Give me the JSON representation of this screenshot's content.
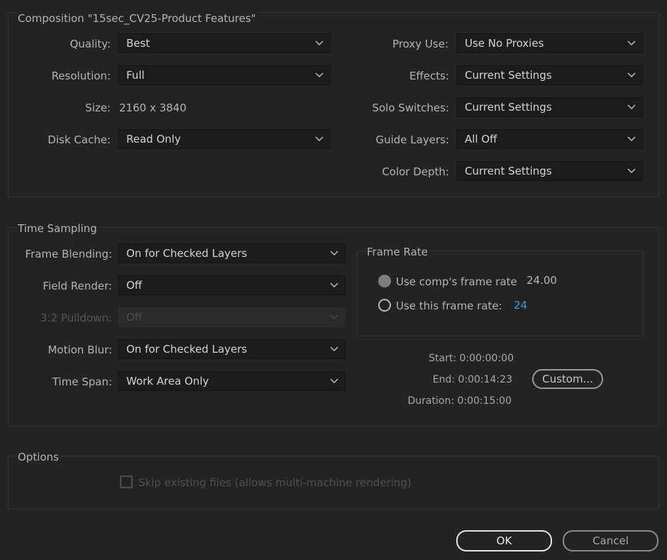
{
  "composition": {
    "legend": "Composition \"15sec_CV25-Product Features\"",
    "quality": {
      "label": "Quality:",
      "value": "Best"
    },
    "resolution": {
      "label": "Resolution:",
      "value": "Full"
    },
    "size": {
      "label": "Size:",
      "value": "2160 x 3840"
    },
    "disk_cache": {
      "label": "Disk Cache:",
      "value": "Read Only"
    },
    "proxy_use": {
      "label": "Proxy Use:",
      "value": "Use No Proxies"
    },
    "effects": {
      "label": "Effects:",
      "value": "Current Settings"
    },
    "solo_switches": {
      "label": "Solo Switches:",
      "value": "Current Settings"
    },
    "guide_layers": {
      "label": "Guide Layers:",
      "value": "All Off"
    },
    "color_depth": {
      "label": "Color Depth:",
      "value": "Current Settings"
    }
  },
  "time_sampling": {
    "legend": "Time Sampling",
    "frame_blending": {
      "label": "Frame Blending:",
      "value": "On for Checked Layers"
    },
    "field_render": {
      "label": "Field Render:",
      "value": "Off"
    },
    "pulldown": {
      "label": "3:2 Pulldown:",
      "value": "Off"
    },
    "motion_blur": {
      "label": "Motion Blur:",
      "value": "On for Checked Layers"
    },
    "time_span": {
      "label": "Time Span:",
      "value": "Work Area Only"
    },
    "frame_rate": {
      "legend": "Frame Rate",
      "use_comp": {
        "label": "Use comp's frame rate",
        "value": "24.00",
        "selected": true
      },
      "use_this": {
        "label": "Use this frame rate:",
        "value": "24",
        "selected": false
      }
    },
    "start": "Start: 0:00:00:00",
    "end": "End: 0:00:14:23",
    "duration": "Duration: 0:00:15:00",
    "custom_button": "Custom..."
  },
  "options": {
    "legend": "Options",
    "skip_existing": {
      "label": "Skip existing files (allows multi-machine rendering)",
      "checked": false
    }
  },
  "buttons": {
    "ok": "OK",
    "cancel": "Cancel"
  },
  "colors": {
    "background": "#232323",
    "accent": "#3d9bea"
  },
  "icons": {
    "dropdown": "chevron-down-icon"
  }
}
